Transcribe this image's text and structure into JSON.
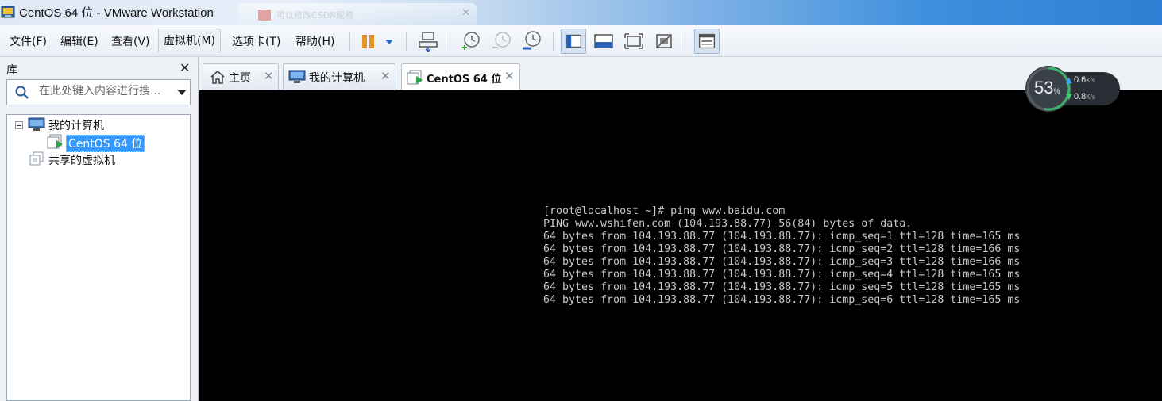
{
  "window": {
    "title": "CentOS 64 位 - VMware Workstation",
    "background_tab_text": "可以修改CSDN昵称"
  },
  "menu": {
    "items": [
      "文件(F)",
      "编辑(E)",
      "查看(V)",
      "虚拟机(M)",
      "选项卡(T)",
      "帮助(H)"
    ],
    "active_index": 3
  },
  "toolbar": {
    "icons": [
      "pause-icon",
      "dropdown-arrow-icon",
      "send-ctrl-alt-del-icon",
      "snapshot-icon",
      "revert-snapshot-icon",
      "snapshot-manager-icon",
      "library-view-icon",
      "console-view-icon",
      "fullscreen-icon",
      "unity-icon",
      "thumbnail-icon"
    ]
  },
  "library": {
    "title": "库",
    "search_placeholder": "在此处键入内容进行搜...",
    "tree": {
      "root": "我的计算机",
      "selected_vm": "CentOS 64 位",
      "shared": "共享的虚拟机"
    }
  },
  "tabs": [
    {
      "label": "主页",
      "icon": "home-icon"
    },
    {
      "label": "我的计算机",
      "icon": "computer-icon"
    },
    {
      "label": "CentOS 64 位",
      "icon": "vm-icon",
      "active": true
    }
  ],
  "console": {
    "lines": [
      "[root@localhost ~]# ping www.baidu.com",
      "PING www.wshifen.com (104.193.88.77) 56(84) bytes of data.",
      "64 bytes from 104.193.88.77 (104.193.88.77): icmp_seq=1 ttl=128 time=165 ms",
      "64 bytes from 104.193.88.77 (104.193.88.77): icmp_seq=2 ttl=128 time=166 ms",
      "64 bytes from 104.193.88.77 (104.193.88.77): icmp_seq=3 ttl=128 time=166 ms",
      "64 bytes from 104.193.88.77 (104.193.88.77): icmp_seq=4 ttl=128 time=165 ms",
      "64 bytes from 104.193.88.77 (104.193.88.77): icmp_seq=5 ttl=128 time=165 ms",
      "64 bytes from 104.193.88.77 (104.193.88.77): icmp_seq=6 ttl=128 time=165 ms"
    ]
  },
  "net_widget": {
    "percent": "53",
    "percent_unit": "%",
    "percent_value": 0.53,
    "upload": "0.6",
    "download": "0.8",
    "rate_unit": "K/s",
    "colors": {
      "ring": "#3fb36b",
      "up": "#36a3ff",
      "down": "#3ccf6b"
    }
  }
}
